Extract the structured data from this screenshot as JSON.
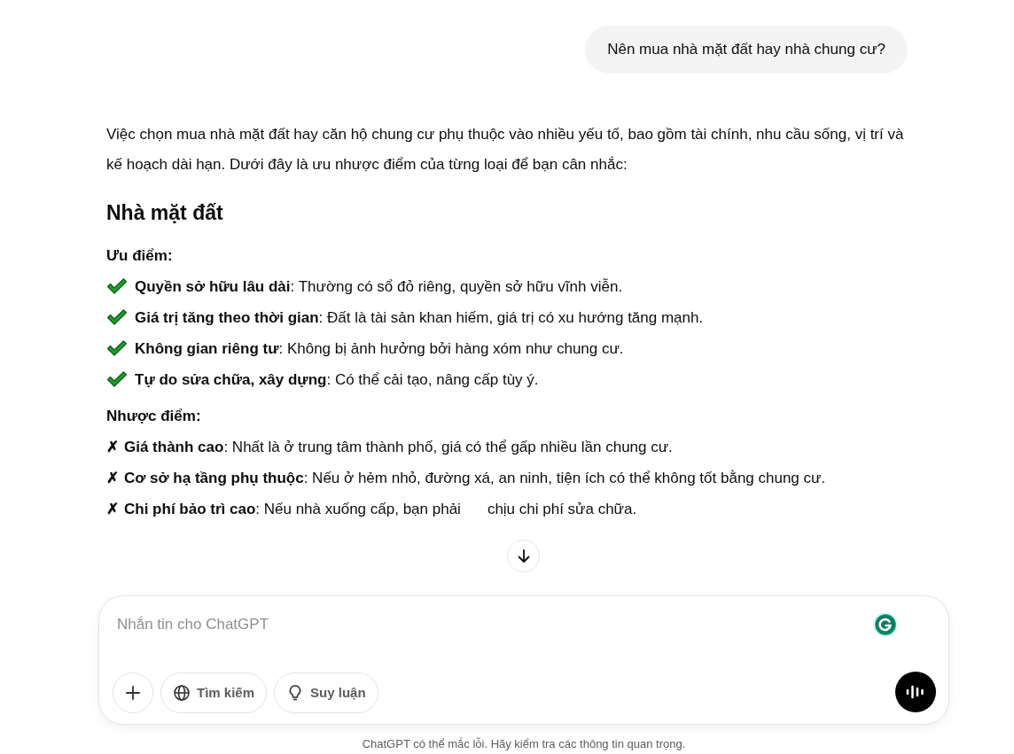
{
  "user_message": "Nên mua nhà mặt đất hay nhà chung cư?",
  "answer": {
    "intro": "Việc chọn mua nhà mặt đất hay căn hộ chung cư phụ thuộc vào nhiều yếu tố, bao gồm tài chính, nhu cầu sống, vị trí và kế hoạch dài hạn. Dưới đây là ưu nhược điểm của từng loại để bạn cân nhắc:",
    "sections": [
      {
        "heading": "Nhà mặt đất",
        "groups": [
          {
            "label": "Ưu điểm:",
            "items": [
              {
                "kind": "check",
                "text": "**Quyền sở hữu lâu dài**: Thường có sổ đỏ riêng, quyền sở hữu vĩnh viễn."
              },
              {
                "kind": "check",
                "text": "**Giá trị tăng theo thời gian**: Đất là tài sản khan hiếm, giá trị có xu hướng tăng mạnh."
              },
              {
                "kind": "check",
                "text": "**Không gian riêng tư**: Không bị ảnh hưởng bởi hàng xóm như chung cư."
              },
              {
                "kind": "check",
                "text": "**Tự do sửa chữa, xây dựng**: Có thể cải tạo, nâng cấp tùy ý."
              }
            ]
          },
          {
            "label": "Nhược điểm:",
            "items": [
              {
                "kind": "cross",
                "marker": "✗",
                "text": "**Giá thành cao**: Nhất là ở trung tâm thành phố, giá có thể gấp nhiều lần chung cư."
              },
              {
                "kind": "cross",
                "marker": "✗",
                "text": "**Cơ sở hạ tầng phụ thuộc**: Nếu ở hẻm nhỏ, đường xá, an ninh, tiện ích có thể không tốt bằng chung cư."
              },
              {
                "kind": "cross",
                "marker": "✗",
                "text": "**Chi phí bảo trì cao**: Nếu nhà xuống cấp, bạn phải",
                "text_after": "chịu chi phí sửa chữa."
              }
            ]
          }
        ]
      }
    ]
  },
  "composer": {
    "placeholder": "Nhắn tin cho ChatGPT",
    "tools": [
      {
        "kind": "plus"
      },
      {
        "kind": "globe",
        "label": "Tìm kiếm"
      },
      {
        "kind": "bulb",
        "label": "Suy luận"
      }
    ]
  },
  "disclaimer": "ChatGPT có thể mắc lỗi. Hãy kiểm tra các thông tin quan trọng."
}
